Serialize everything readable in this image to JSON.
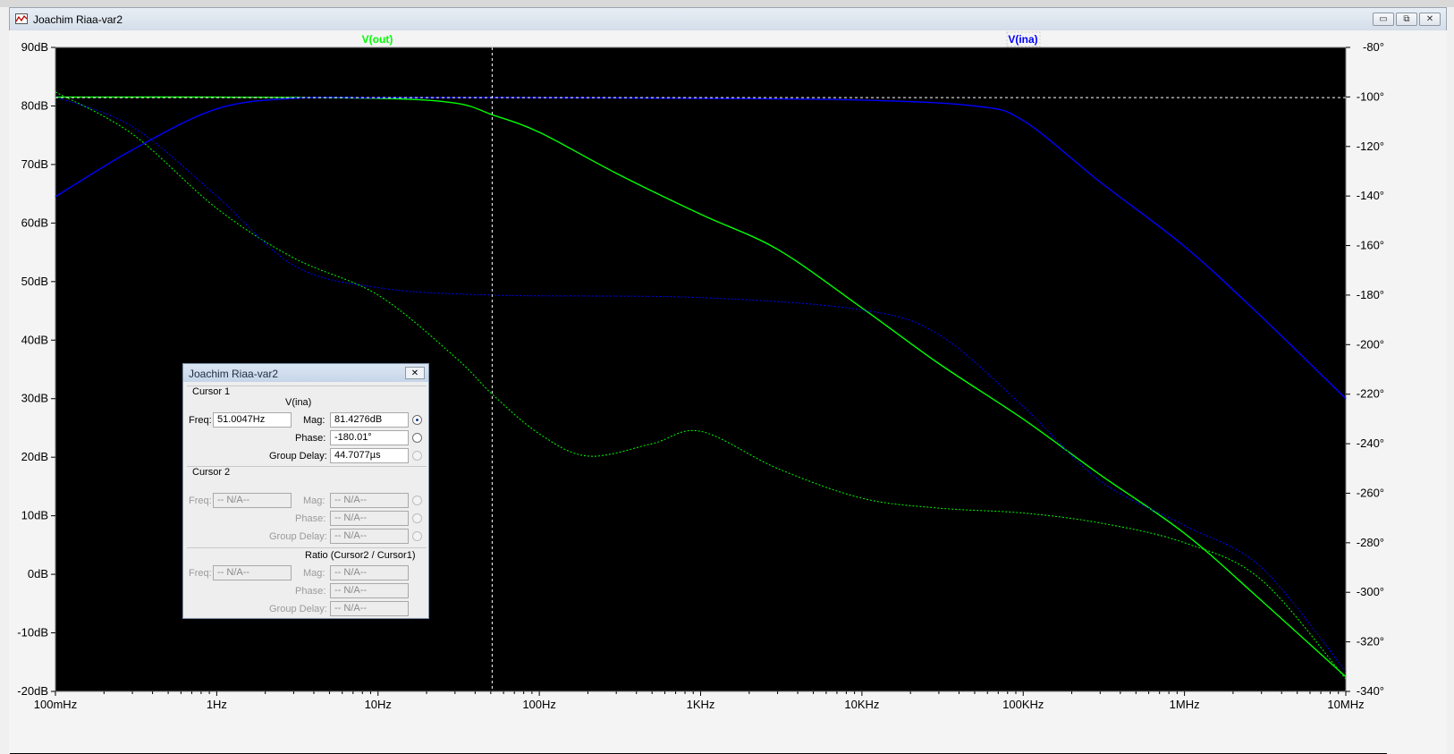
{
  "window": {
    "title": "Joachim Riaa-var2",
    "minimize_label": "▭",
    "restore_label": "⧉",
    "close_label": "✕",
    "app_icon": "plot-icon"
  },
  "colors": {
    "plot_bg": "#000000",
    "vout": "#00ff00",
    "vina": "#0000ff",
    "grid_ref": "#ffffff"
  },
  "cursor_dialog": {
    "title": "Joachim Riaa-var2",
    "close_label": "✕",
    "cursor1": {
      "label": "Cursor 1",
      "trace_name": "V(ina)",
      "freq_label": "Freq:",
      "freq_value": "51.0047Hz",
      "mag_label": "Mag:",
      "mag_value": "81.4276dB",
      "phase_label": "Phase:",
      "phase_value": "-180.01°",
      "group_delay_label": "Group Delay:",
      "group_delay_value": "44.7077µs"
    },
    "cursor2": {
      "label": "Cursor 2",
      "freq_label": "Freq:",
      "freq_value": "-- N/A--",
      "mag_label": "Mag:",
      "mag_value": "-- N/A--",
      "phase_label": "Phase:",
      "phase_value": "-- N/A--",
      "group_delay_label": "Group Delay:",
      "group_delay_value": "-- N/A--"
    },
    "ratio": {
      "label": "Ratio (Cursor2 / Cursor1)",
      "freq_label": "Freq:",
      "freq_value": "-- N/A--",
      "mag_label": "Mag:",
      "mag_value": "-- N/A--",
      "phase_label": "Phase:",
      "phase_value": "-- N/A--",
      "group_delay_label": "Group Delay:",
      "group_delay_value": "-- N/A--"
    }
  },
  "chart_data": {
    "type": "line",
    "x_scale": "log",
    "xlim": [
      0.1,
      10000000
    ],
    "x_ticks": [
      "100mHz",
      "1Hz",
      "10Hz",
      "100Hz",
      "1KHz",
      "10KHz",
      "100KHz",
      "1MHz",
      "10MHz"
    ],
    "ylim_left": [
      -20,
      90
    ],
    "y_ticks_left": [
      "90dB",
      "80dB",
      "70dB",
      "60dB",
      "50dB",
      "40dB",
      "30dB",
      "20dB",
      "10dB",
      "0dB",
      "-10dB",
      "-20dB"
    ],
    "ylim_right": [
      -340,
      -80
    ],
    "y_ticks_right": [
      "-80°",
      "-100°",
      "-120°",
      "-140°",
      "-160°",
      "-180°",
      "-200°",
      "-220°",
      "-240°",
      "-260°",
      "-280°",
      "-300°",
      "-320°",
      "-340°"
    ],
    "grid": false,
    "cursor": {
      "x": 51.0047,
      "mag": 81.4276
    },
    "series": [
      {
        "name": "V(out)",
        "color": "#00ff00",
        "magnitude_db": [
          [
            0.1,
            81.5
          ],
          [
            1,
            81.5
          ],
          [
            10,
            81.3
          ],
          [
            30,
            80.5
          ],
          [
            51,
            78.5
          ],
          [
            100,
            75.5
          ],
          [
            300,
            68.5
          ],
          [
            1000,
            61.5
          ],
          [
            3000,
            55.5
          ],
          [
            10000,
            45.5
          ],
          [
            30000,
            36
          ],
          [
            100000,
            26.5
          ],
          [
            300000,
            17
          ],
          [
            1000000,
            7
          ],
          [
            3000000,
            -4.5
          ],
          [
            10000000,
            -17.5
          ]
        ],
        "phase_deg": [
          [
            0.1,
            -98
          ],
          [
            0.3,
            -115
          ],
          [
            1,
            -145
          ],
          [
            3,
            -165
          ],
          [
            10,
            -180
          ],
          [
            30,
            -205
          ],
          [
            51,
            -220
          ],
          [
            100,
            -236
          ],
          [
            200,
            -245
          ],
          [
            500,
            -240
          ],
          [
            1000,
            -235
          ],
          [
            3000,
            -250
          ],
          [
            10000,
            -262
          ],
          [
            30000,
            -266
          ],
          [
            100000,
            -268
          ],
          [
            300000,
            -272
          ],
          [
            1000000,
            -280
          ],
          [
            3000000,
            -295
          ],
          [
            10000000,
            -335
          ]
        ]
      },
      {
        "name": "V(ina)",
        "color": "#0000ff",
        "magnitude_db": [
          [
            0.1,
            64.5
          ],
          [
            0.3,
            72.5
          ],
          [
            1,
            79.5
          ],
          [
            3,
            81.3
          ],
          [
            10,
            81.4
          ],
          [
            51,
            81.43
          ],
          [
            1000,
            81.3
          ],
          [
            10000,
            81
          ],
          [
            50000,
            80
          ],
          [
            100000,
            77.5
          ],
          [
            300000,
            67
          ],
          [
            1000000,
            56
          ],
          [
            3000000,
            44
          ],
          [
            10000000,
            30
          ]
        ],
        "phase_deg": [
          [
            0.1,
            -100
          ],
          [
            0.3,
            -112
          ],
          [
            1,
            -140
          ],
          [
            3,
            -168
          ],
          [
            10,
            -177
          ],
          [
            51,
            -180
          ],
          [
            1000,
            -181
          ],
          [
            10000,
            -186
          ],
          [
            30000,
            -196
          ],
          [
            100000,
            -225
          ],
          [
            300000,
            -255
          ],
          [
            1000000,
            -273
          ],
          [
            3000000,
            -290
          ],
          [
            10000000,
            -332
          ]
        ]
      }
    ]
  }
}
